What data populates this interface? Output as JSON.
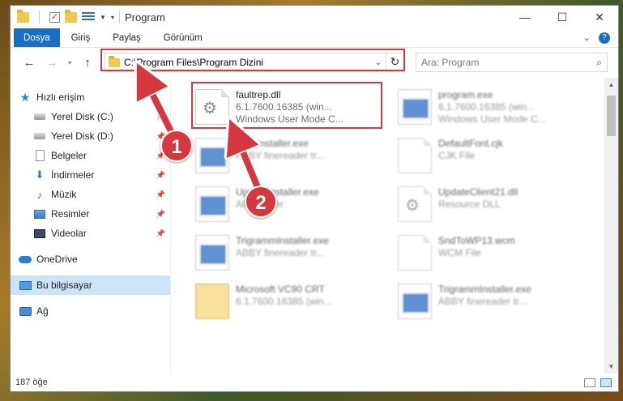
{
  "window": {
    "title": "Program",
    "minimize_icon": "minimize-icon",
    "maximize_icon": "maximize-icon",
    "close_icon": "close-icon"
  },
  "ribbon": {
    "tabs": [
      {
        "label": "Dosya"
      },
      {
        "label": "Giriş"
      },
      {
        "label": "Paylaş"
      },
      {
        "label": "Görünüm"
      }
    ]
  },
  "address": {
    "path": "C:\\Program Files\\Program Dizini",
    "search_placeholder": "Ara: Program"
  },
  "nav_pane": {
    "quick_access": "Hızlı erişim",
    "items": [
      {
        "label": "Yerel Disk (C:)"
      },
      {
        "label": "Yerel Disk (D:)"
      },
      {
        "label": "Belgeler"
      },
      {
        "label": "İndirmeler"
      },
      {
        "label": "Müzik"
      },
      {
        "label": "Resimler"
      },
      {
        "label": "Videolar"
      }
    ],
    "onedrive": "OneDrive",
    "this_pc": "Bu bilgisayar",
    "network": "Ağ"
  },
  "files": [
    {
      "name": "faultrep.dll",
      "line2": "6.1.7600.16385 (win...",
      "line3": "Windows User Mode C...",
      "icon": "gear-file-icon"
    },
    {
      "name": "program.exe",
      "line2": "6.1.7600.16385 (win...",
      "line3": "Windows User Mode C...",
      "icon": "app-icon"
    },
    {
      "name": "MsmInstaller.exe",
      "line2": "ABBY finereader tr...",
      "line3": "",
      "icon": "app-icon"
    },
    {
      "name": "DefaultFont.cjk",
      "line2": "CJK File",
      "line3": "",
      "icon": "page-icon"
    },
    {
      "name": "UpdateInstaller.exe",
      "line2": "All Installer",
      "line3": "",
      "icon": "app-icon"
    },
    {
      "name": "UpdateClient21.dll",
      "line2": "Resource DLL",
      "line3": "",
      "icon": "gear-file-icon"
    },
    {
      "name": "TrigrammInstaller.exe",
      "line2": "ABBY finereader tr...",
      "line3": "",
      "icon": "app-icon"
    },
    {
      "name": "SndToWP13.wcm",
      "line2": "WCM File",
      "line3": "",
      "icon": "page-icon"
    },
    {
      "name": "Microsoft VC90 CRT",
      "line2": "6.1.7600.16385 (win...",
      "line3": "",
      "icon": "archive-icon"
    },
    {
      "name": "TrigrammInstaller.exe",
      "line2": "ABBY finereader tr...",
      "line3": "",
      "icon": "app-icon"
    }
  ],
  "status": {
    "count": "187 öğe"
  },
  "annotations": {
    "badge1": "1",
    "badge2": "2",
    "color": "#d6383f"
  }
}
